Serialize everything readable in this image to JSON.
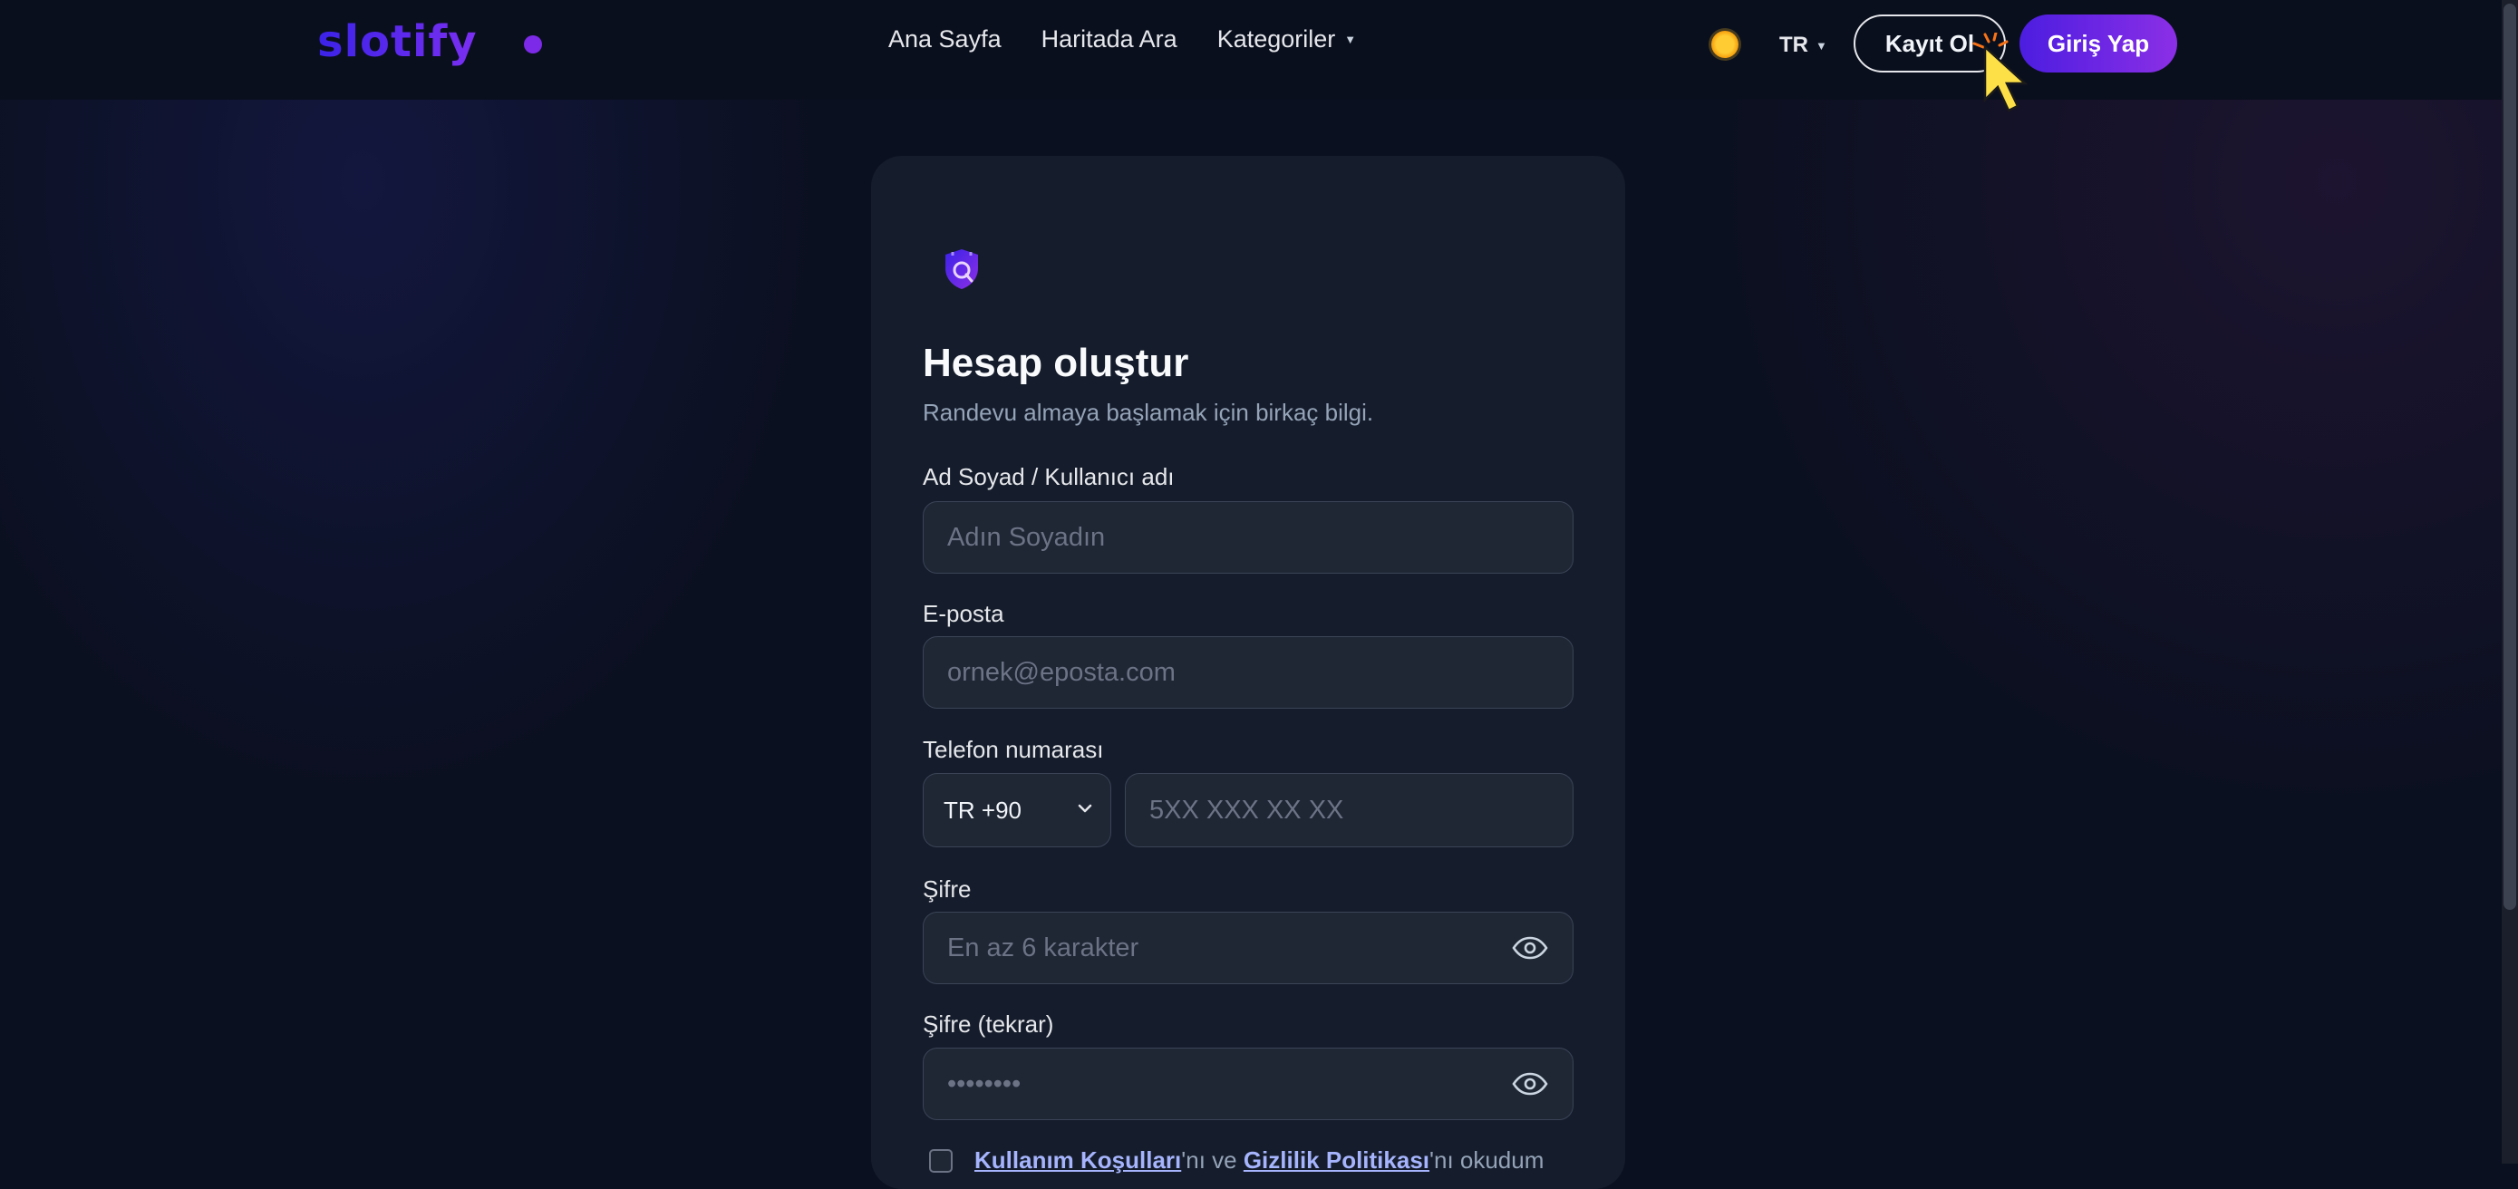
{
  "header": {
    "logo": "slotify",
    "nav": [
      {
        "label": "Ana Sayfa"
      },
      {
        "label": "Haritada Ara"
      },
      {
        "label": "Kategoriler"
      }
    ],
    "language": "TR",
    "register_label": "Kayıt Ol",
    "login_label": "Giriş Yap",
    "theme_icon": "sun-icon"
  },
  "form": {
    "icon": "shield-icon",
    "title": "Hesap oluştur",
    "subtitle": "Randevu almaya başlamak için birkaç bilgi.",
    "name": {
      "label": "Ad Soyad / Kullanıcı adı",
      "placeholder": "Adın Soyadın",
      "value": ""
    },
    "email": {
      "label": "E-posta",
      "placeholder": "ornek@eposta.com",
      "value": ""
    },
    "phone": {
      "label": "Telefon numarası",
      "country": "TR +90",
      "placeholder": "5XX XXX XX XX",
      "value": ""
    },
    "password": {
      "label": "Şifre",
      "placeholder": "En az 6 karakter",
      "value": ""
    },
    "password_confirm": {
      "label": "Şifre (tekrar)",
      "placeholder": "••••••••",
      "value": ""
    },
    "terms": {
      "link1": "Kullanım Koşulları",
      "mid": "'nı ve ",
      "link2": "Gizlilik Politikası",
      "end": "'nı okudum"
    }
  },
  "colors": {
    "background": "#0b1020",
    "card": "#151c2b",
    "accent_start": "#4c1de0",
    "accent_end": "#8b2fe6"
  }
}
